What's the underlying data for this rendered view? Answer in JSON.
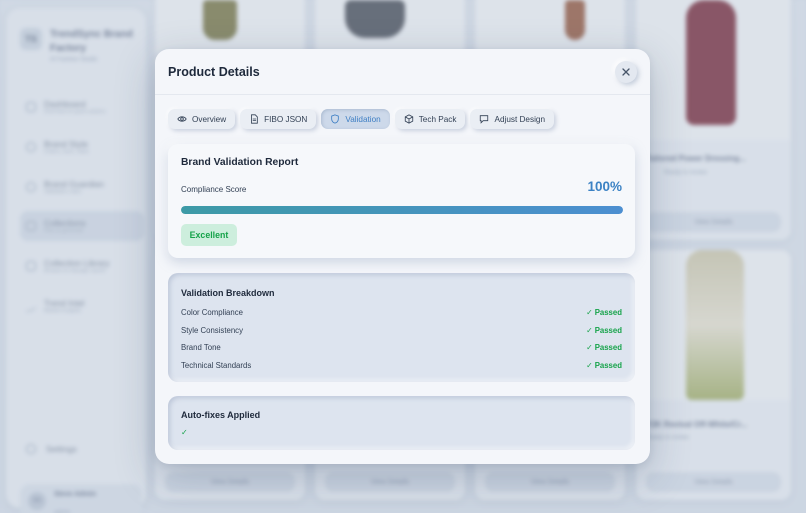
{
  "background": {
    "brand": {
      "logo": "TS",
      "name": "TrendSync Brand Factory",
      "subtitle": "AI Fashion Studio"
    },
    "nav": [
      {
        "label": "Dashboard",
        "sub": "Overview & quick actions"
      },
      {
        "label": "Brand Style",
        "sub": "Colors, tone, rules"
      },
      {
        "label": "Brand Guardian",
        "sub": "Validation rules"
      },
      {
        "label": "Collections",
        "sub": "Plan & generate"
      },
      {
        "label": "Collection Library",
        "sub": "Browse & manage saved"
      },
      {
        "label": "Trend Intel",
        "sub": "Market insights"
      }
    ],
    "settings_label": "Settings",
    "user": {
      "initials": "SA",
      "name": "Steve Admin",
      "role": "admin"
    },
    "cards": [
      {
        "title": "",
        "button": "View Details"
      },
      {
        "title": "",
        "button": "View Details"
      },
      {
        "title": "",
        "button": "View Details"
      },
      {
        "title": "Tailored Power Dressing...",
        "meta": "Ready to review",
        "button": "View Details"
      },
      {
        "title": "",
        "button": "View Details"
      },
      {
        "title": "",
        "button": "View Details"
      },
      {
        "title": "",
        "button": "View Details"
      },
      {
        "title": "Y2K Revival Off-White/Cr...",
        "meta": "Ready to review",
        "button": "View Details"
      }
    ]
  },
  "modal": {
    "title": "Product Details",
    "close_icon": "close-icon",
    "tabs": [
      {
        "label": "Overview",
        "icon": "eye-icon",
        "active": false
      },
      {
        "label": "FIBO JSON",
        "icon": "document-icon",
        "active": false
      },
      {
        "label": "Validation",
        "icon": "shield-icon",
        "active": true
      },
      {
        "label": "Tech Pack",
        "icon": "box-icon",
        "active": false
      },
      {
        "label": "Adjust Design",
        "icon": "message-icon",
        "active": false
      }
    ],
    "report": {
      "title": "Brand Validation Report",
      "score_label": "Compliance Score",
      "score_value": "100%",
      "score_fraction": 1.0,
      "rating": "Excellent"
    },
    "breakdown": {
      "title": "Validation Breakdown",
      "items": [
        {
          "label": "Color Compliance",
          "status": "Passed"
        },
        {
          "label": "Style Consistency",
          "status": "Passed"
        },
        {
          "label": "Brand Tone",
          "status": "Passed"
        },
        {
          "label": "Technical Standards",
          "status": "Passed"
        }
      ]
    },
    "autofix": {
      "title": "Auto-fixes Applied",
      "check": "✓"
    }
  },
  "colors": {
    "accent": "#3b82c4",
    "success": "#16a34a",
    "success_bg": "#cdeedd"
  }
}
